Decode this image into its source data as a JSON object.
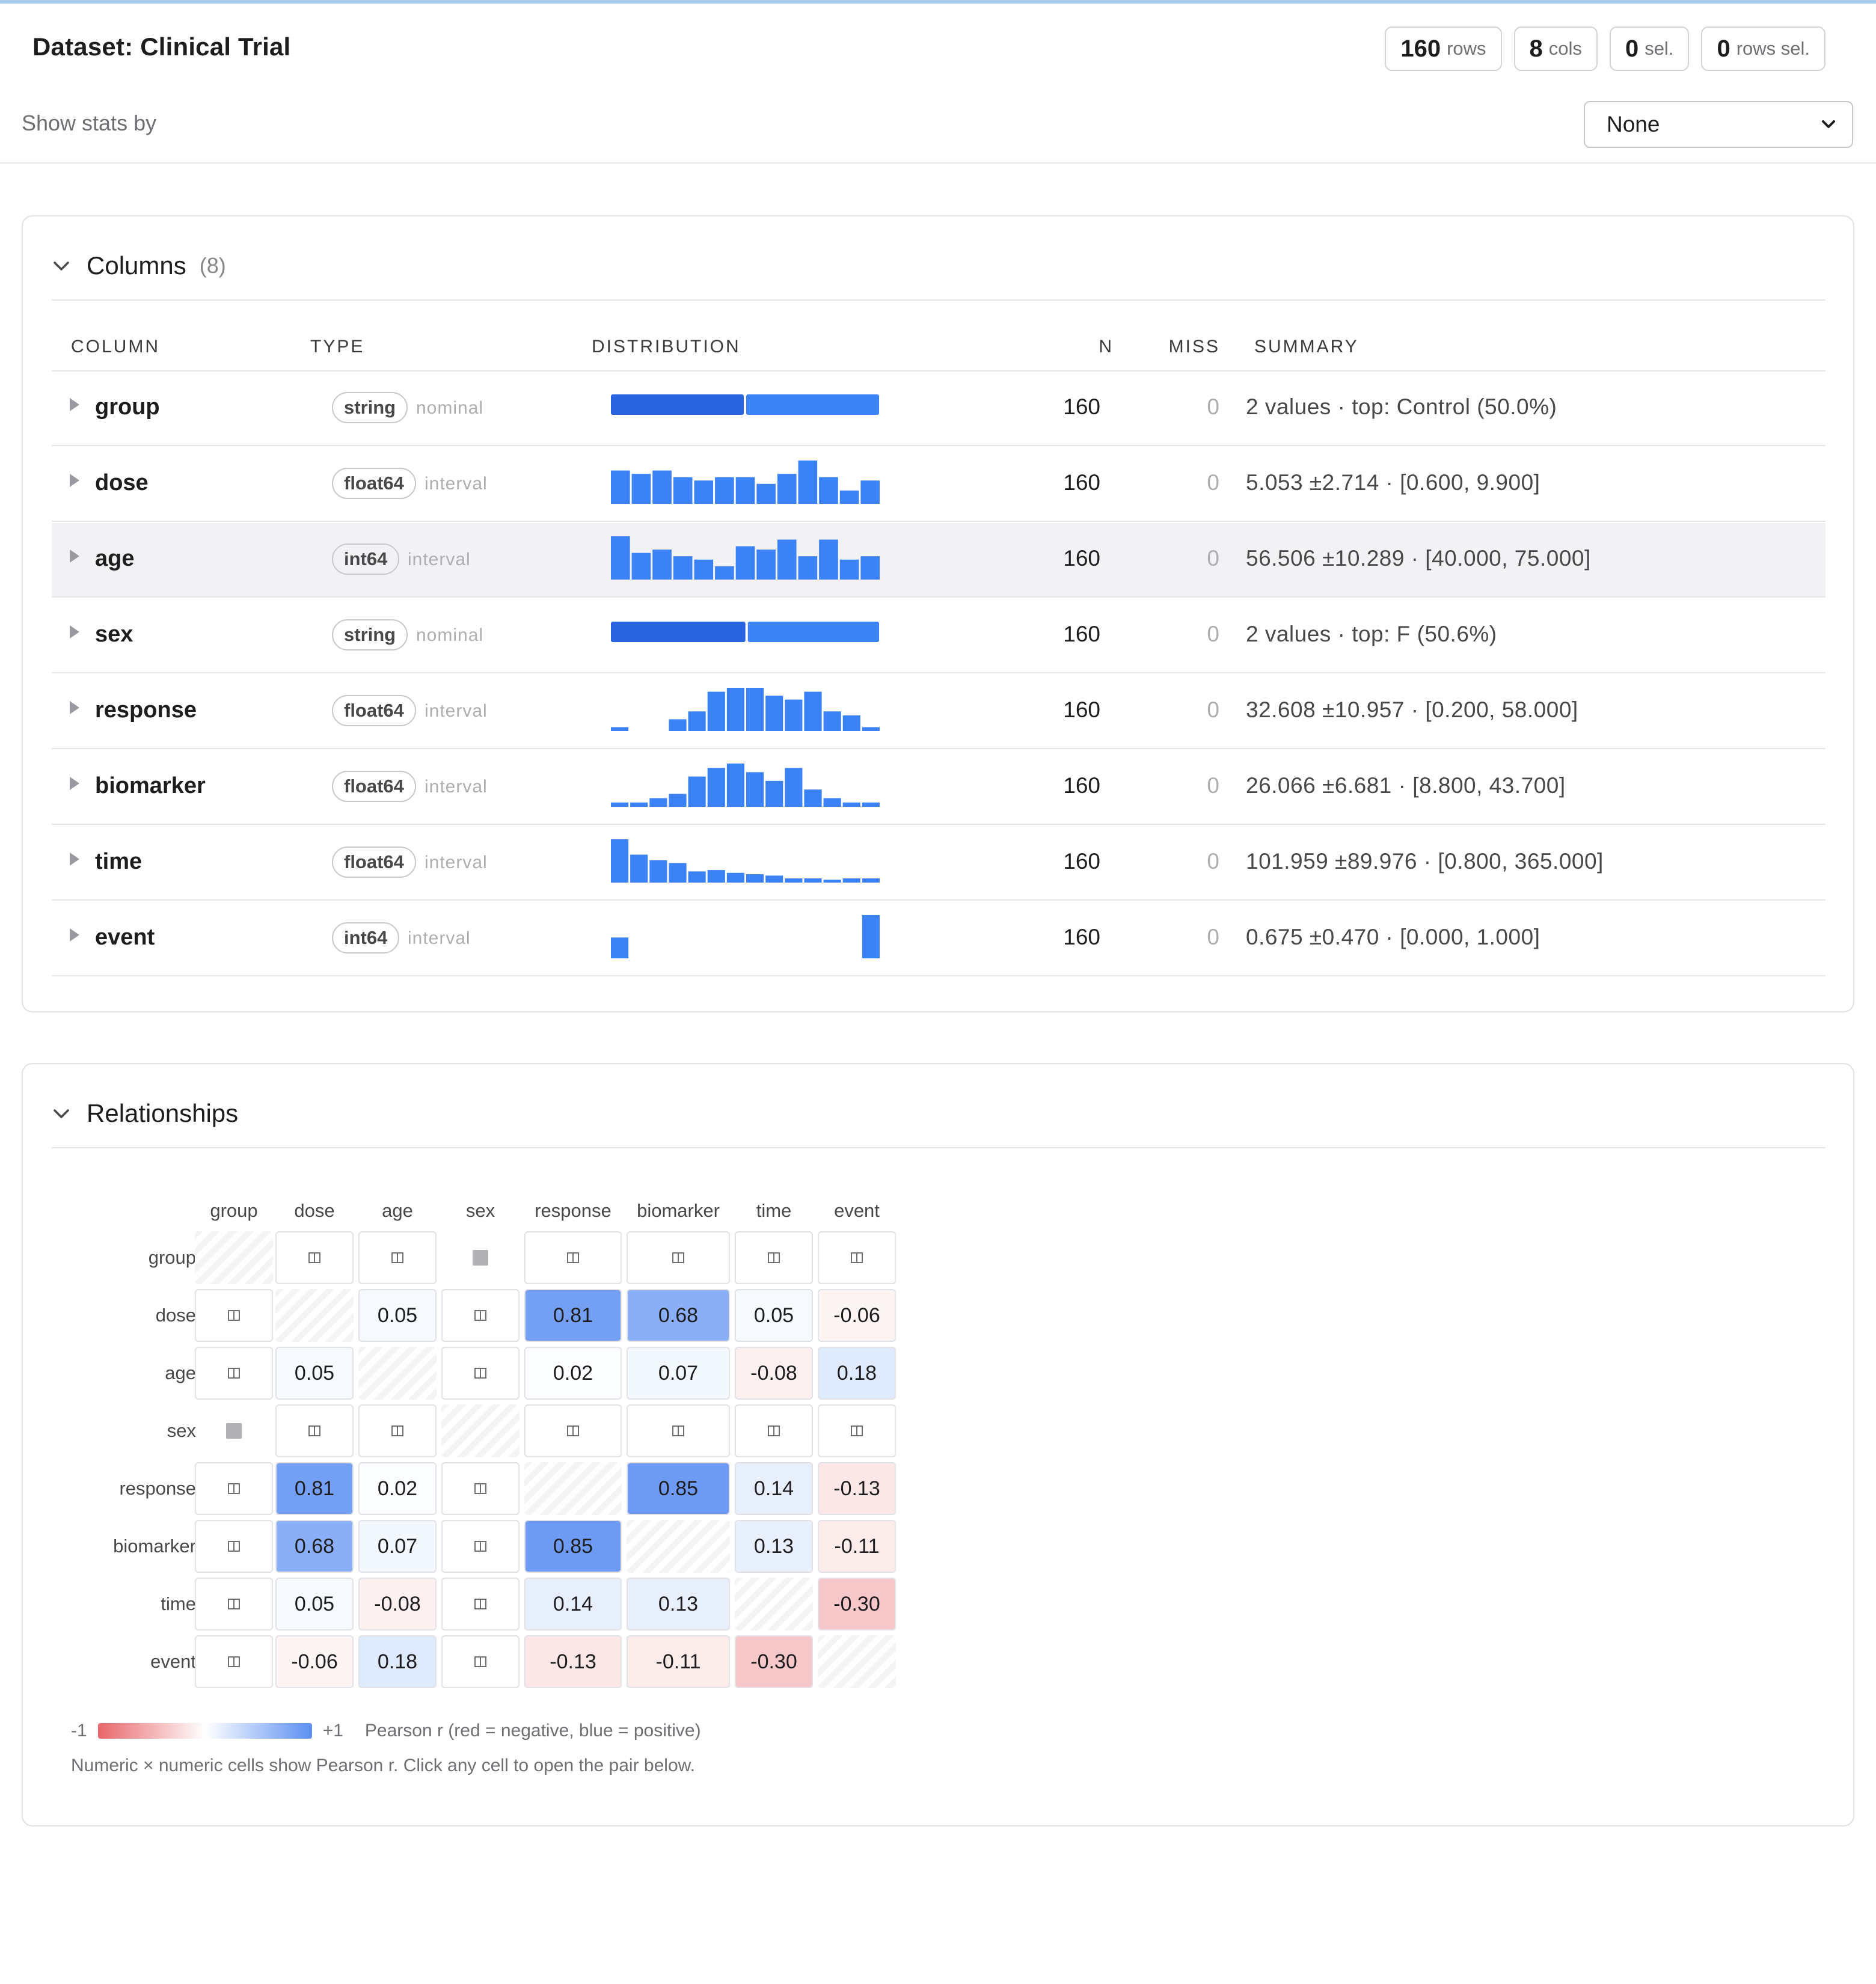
{
  "header": {
    "title": "Dataset: Clinical Trial",
    "pills": [
      {
        "num": "160",
        "label": "rows"
      },
      {
        "num": "8",
        "label": "cols"
      },
      {
        "num": "0",
        "label": "sel."
      },
      {
        "num": "0",
        "label": "rows sel."
      }
    ],
    "stats_label": "Show stats by",
    "stats_select": "None"
  },
  "columns_panel": {
    "title": "Columns",
    "count": "(8)",
    "headers": {
      "column": "COLUMN",
      "type": "TYPE",
      "distribution": "DISTRIBUTION",
      "n": "N",
      "miss": "MISS",
      "summary": "SUMMARY"
    },
    "rows": [
      {
        "name": "group",
        "dtype": "string",
        "mtype": "nominal",
        "n": "160",
        "miss": "0",
        "summary": "2 values · top: Control (50.0%)",
        "kind": "cat",
        "dist": [
          0.5,
          0.5
        ]
      },
      {
        "name": "dose",
        "dtype": "float64",
        "mtype": "interval",
        "n": "160",
        "miss": "0",
        "summary": "5.053 ±2.714 · [0.600, 9.900]",
        "kind": "hist",
        "dist": [
          10,
          9,
          10,
          8,
          7,
          8,
          8,
          6,
          9,
          13,
          8,
          4,
          7
        ]
      },
      {
        "name": "age",
        "dtype": "int64",
        "mtype": "interval",
        "n": "160",
        "miss": "0",
        "summary": "56.506 ±10.289 · [40.000, 75.000]",
        "kind": "hist",
        "dist": [
          13,
          8,
          9,
          7,
          6,
          4,
          10,
          9,
          12,
          7,
          12,
          6,
          7
        ]
      },
      {
        "name": "sex",
        "dtype": "string",
        "mtype": "nominal",
        "n": "160",
        "miss": "0",
        "summary": "2 values · top: F (50.6%)",
        "kind": "cat",
        "dist": [
          0.506,
          0.494
        ]
      },
      {
        "name": "response",
        "dtype": "float64",
        "mtype": "interval",
        "n": "160",
        "miss": "0",
        "summary": "32.608 ±10.957 · [0.200, 58.000]",
        "kind": "hist",
        "dist": [
          1,
          0,
          0,
          3,
          5,
          10,
          11,
          11,
          9,
          8,
          10,
          5,
          4,
          1
        ]
      },
      {
        "name": "biomarker",
        "dtype": "float64",
        "mtype": "interval",
        "n": "160",
        "miss": "0",
        "summary": "26.066 ±6.681 · [8.800, 43.700]",
        "kind": "hist",
        "dist": [
          1,
          1,
          2,
          3,
          7,
          9,
          10,
          8,
          6,
          9,
          4,
          2,
          1,
          1
        ]
      },
      {
        "name": "time",
        "dtype": "float64",
        "mtype": "interval",
        "n": "160",
        "miss": "0",
        "summary": "101.959 ±89.976 · [0.800, 365.000]",
        "kind": "hist",
        "dist": [
          31,
          20,
          16,
          14,
          8,
          9,
          7,
          6,
          5,
          3,
          3,
          2,
          3,
          3
        ]
      },
      {
        "name": "event",
        "dtype": "int64",
        "mtype": "interval",
        "n": "160",
        "miss": "0",
        "summary": "0.675 ±0.470 · [0.000, 1.000]",
        "kind": "hist",
        "dist": [
          52,
          0,
          0,
          0,
          0,
          0,
          0,
          0,
          0,
          0,
          0,
          0,
          0,
          108
        ]
      }
    ]
  },
  "relationships_panel": {
    "title": "Relationships",
    "variables": [
      "group",
      "dose",
      "age",
      "sex",
      "response",
      "biomarker",
      "time",
      "event"
    ],
    "matrix": [
      [
        "diag",
        "split",
        "split",
        "block",
        "split",
        "split",
        "split",
        "split"
      ],
      [
        "split",
        "diag",
        "0.05",
        "split",
        "0.81",
        "0.68",
        "0.05",
        "-0.06"
      ],
      [
        "split",
        "0.05",
        "diag",
        "split",
        "0.02",
        "0.07",
        "-0.08",
        "0.18"
      ],
      [
        "block",
        "split",
        "split",
        "diag",
        "split",
        "split",
        "split",
        "split"
      ],
      [
        "split",
        "0.81",
        "0.02",
        "split",
        "diag",
        "0.85",
        "0.14",
        "-0.13"
      ],
      [
        "split",
        "0.68",
        "0.07",
        "split",
        "0.85",
        "diag",
        "0.13",
        "-0.11"
      ],
      [
        "split",
        "0.05",
        "-0.08",
        "split",
        "0.14",
        "0.13",
        "diag",
        "-0.30"
      ],
      [
        "split",
        "-0.06",
        "0.18",
        "split",
        "-0.13",
        "-0.11",
        "-0.30",
        "diag"
      ]
    ],
    "legend": {
      "min": "-1",
      "max": "+1",
      "text": "Pearson r (red = negative, blue = positive)"
    },
    "note": "Numeric × numeric cells show Pearson r. Click any cell to open the pair below."
  },
  "colors": {
    "bar_dark": "#2a63e0",
    "bar": "#3b82f6",
    "positive": "#5b8ff2",
    "negative": "#e8666a",
    "accent": "#a7cdef"
  }
}
